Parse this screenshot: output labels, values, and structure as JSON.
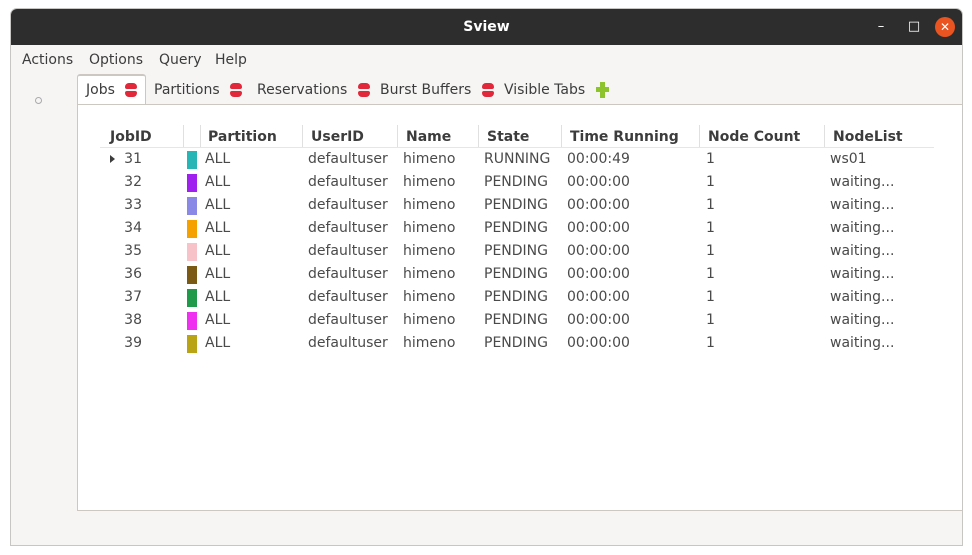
{
  "window": {
    "title": "Sview"
  },
  "window_controls": {
    "minimize": "–",
    "maximize": "□",
    "close": "✕"
  },
  "menubar": [
    "Actions",
    "Options",
    "Query",
    "Help"
  ],
  "tabs": [
    {
      "label": "Jobs",
      "icon": "database-icon",
      "active": true
    },
    {
      "label": "Partitions",
      "icon": "database-icon"
    },
    {
      "label": "Reservations",
      "icon": "database-icon"
    },
    {
      "label": "Burst Buffers",
      "icon": "database-icon"
    },
    {
      "label": "Visible Tabs",
      "icon": "plus-icon"
    }
  ],
  "table": {
    "columns": [
      "JobID",
      "Partition",
      "UserID",
      "Name",
      "State",
      "Time Running",
      "Node Count",
      "NodeList"
    ],
    "rows": [
      {
        "jobid": "31",
        "color": "#26b6b6",
        "partition": "ALL",
        "userid": "defaultuser",
        "name": "himeno",
        "state": "RUNNING",
        "time": "00:00:49",
        "nodes": "1",
        "nodelist": "ws01",
        "expandable": true
      },
      {
        "jobid": "32",
        "color": "#a020f0",
        "partition": "ALL",
        "userid": "defaultuser",
        "name": "himeno",
        "state": "PENDING",
        "time": "00:00:00",
        "nodes": "1",
        "nodelist": "waiting..."
      },
      {
        "jobid": "33",
        "color": "#8a8ae6",
        "partition": "ALL",
        "userid": "defaultuser",
        "name": "himeno",
        "state": "PENDING",
        "time": "00:00:00",
        "nodes": "1",
        "nodelist": "waiting..."
      },
      {
        "jobid": "34",
        "color": "#f5a100",
        "partition": "ALL",
        "userid": "defaultuser",
        "name": "himeno",
        "state": "PENDING",
        "time": "00:00:00",
        "nodes": "1",
        "nodelist": "waiting..."
      },
      {
        "jobid": "35",
        "color": "#f7c2c8",
        "partition": "ALL",
        "userid": "defaultuser",
        "name": "himeno",
        "state": "PENDING",
        "time": "00:00:00",
        "nodes": "1",
        "nodelist": "waiting..."
      },
      {
        "jobid": "36",
        "color": "#7a5a14",
        "partition": "ALL",
        "userid": "defaultuser",
        "name": "himeno",
        "state": "PENDING",
        "time": "00:00:00",
        "nodes": "1",
        "nodelist": "waiting..."
      },
      {
        "jobid": "37",
        "color": "#1e9a4a",
        "partition": "ALL",
        "userid": "defaultuser",
        "name": "himeno",
        "state": "PENDING",
        "time": "00:00:00",
        "nodes": "1",
        "nodelist": "waiting..."
      },
      {
        "jobid": "38",
        "color": "#f030f0",
        "partition": "ALL",
        "userid": "defaultuser",
        "name": "himeno",
        "state": "PENDING",
        "time": "00:00:00",
        "nodes": "1",
        "nodelist": "waiting..."
      },
      {
        "jobid": "39",
        "color": "#b8a414",
        "partition": "ALL",
        "userid": "defaultuser",
        "name": "himeno",
        "state": "PENDING",
        "time": "00:00:00",
        "nodes": "1",
        "nodelist": "waiting..."
      }
    ]
  }
}
